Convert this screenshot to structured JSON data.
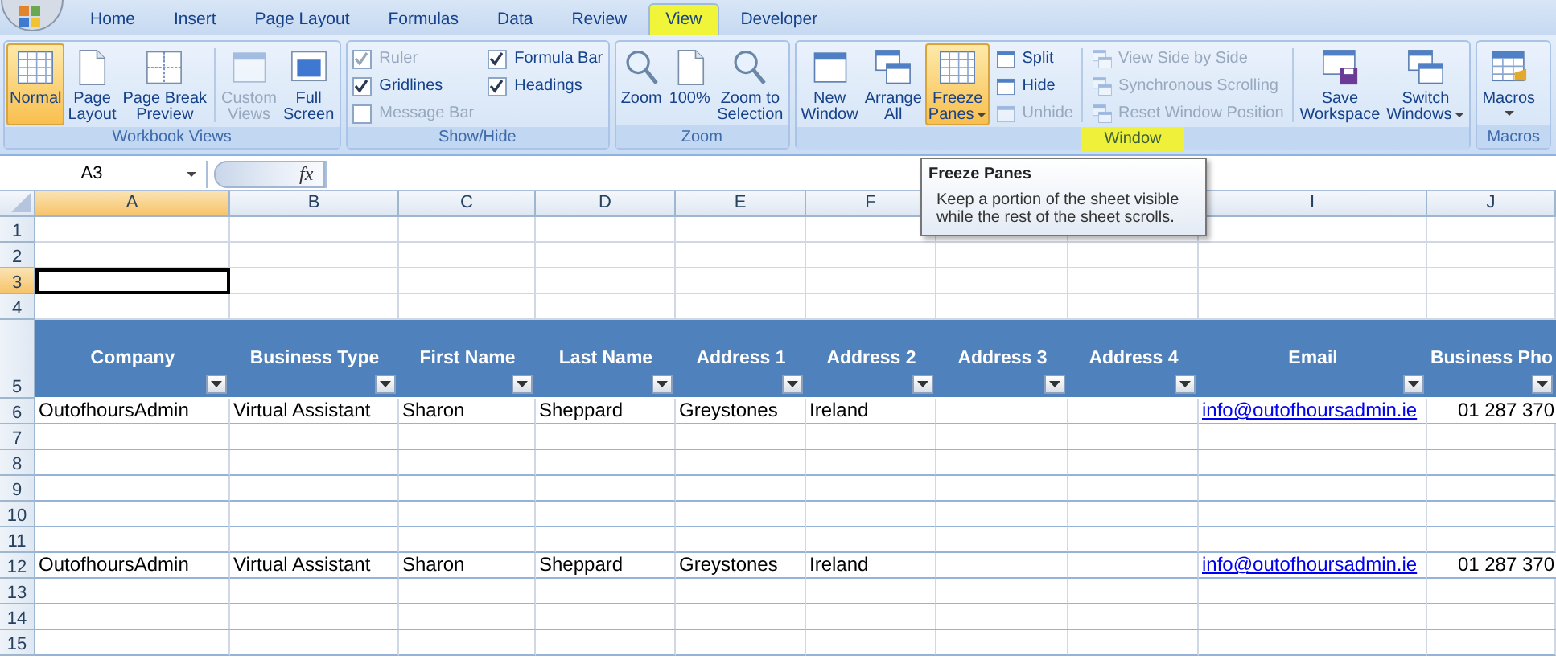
{
  "tabs": [
    {
      "label": "Home",
      "selected": false,
      "highlighted": false
    },
    {
      "label": "Insert",
      "selected": false,
      "highlighted": false
    },
    {
      "label": "Page Layout",
      "selected": false,
      "highlighted": false
    },
    {
      "label": "Formulas",
      "selected": false,
      "highlighted": false
    },
    {
      "label": "Data",
      "selected": false,
      "highlighted": false
    },
    {
      "label": "Review",
      "selected": false,
      "highlighted": false
    },
    {
      "label": "View",
      "selected": true,
      "highlighted": true
    },
    {
      "label": "Developer",
      "selected": false,
      "highlighted": false
    }
  ],
  "ribbon": {
    "groups": [
      {
        "label": "Workbook Views",
        "highlighted": false,
        "items": [
          {
            "kind": "large",
            "label": "Normal",
            "selected": true,
            "disabled": false,
            "dropdown": false
          },
          {
            "kind": "large",
            "label": "Page\nLayout",
            "selected": false,
            "disabled": false,
            "dropdown": false
          },
          {
            "kind": "large",
            "label": "Page Break\nPreview",
            "selected": false,
            "disabled": false,
            "dropdown": false
          },
          {
            "kind": "separator"
          },
          {
            "kind": "large",
            "label": "Custom\nViews",
            "selected": false,
            "disabled": true,
            "dropdown": false
          },
          {
            "kind": "large",
            "label": "Full\nScreen",
            "selected": false,
            "disabled": false,
            "dropdown": false
          }
        ]
      },
      {
        "label": "Show/Hide",
        "highlighted": false,
        "items": [
          {
            "kind": "stack",
            "items": [
              {
                "kind": "check",
                "label": "Ruler",
                "checked": true,
                "disabled": true
              },
              {
                "kind": "check",
                "label": "Gridlines",
                "checked": true,
                "disabled": false
              },
              {
                "kind": "check",
                "label": "Message Bar",
                "checked": false,
                "disabled": true
              }
            ]
          },
          {
            "kind": "stack",
            "items": [
              {
                "kind": "check",
                "label": "Formula Bar",
                "checked": true,
                "disabled": false
              },
              {
                "kind": "check",
                "label": "Headings",
                "checked": true,
                "disabled": false
              }
            ]
          }
        ]
      },
      {
        "label": "Zoom",
        "highlighted": false,
        "items": [
          {
            "kind": "large",
            "label": "Zoom",
            "selected": false,
            "disabled": false,
            "dropdown": false
          },
          {
            "kind": "large",
            "label": "100%",
            "selected": false,
            "disabled": false,
            "dropdown": false
          },
          {
            "kind": "large",
            "label": "Zoom to\nSelection",
            "selected": false,
            "disabled": false,
            "dropdown": false
          }
        ]
      },
      {
        "label": "Window",
        "highlighted": true,
        "items": [
          {
            "kind": "large",
            "label": "New\nWindow",
            "selected": false,
            "disabled": false,
            "dropdown": false
          },
          {
            "kind": "large",
            "label": "Arrange\nAll",
            "selected": false,
            "disabled": false,
            "dropdown": false
          },
          {
            "kind": "large",
            "label": "Freeze\nPanes",
            "selected": true,
            "disabled": false,
            "dropdown": true
          },
          {
            "kind": "stack",
            "items": [
              {
                "kind": "small",
                "label": "Split",
                "disabled": false
              },
              {
                "kind": "small",
                "label": "Hide",
                "disabled": false
              },
              {
                "kind": "small",
                "label": "Unhide",
                "disabled": true
              }
            ]
          },
          {
            "kind": "separator"
          },
          {
            "kind": "stack",
            "items": [
              {
                "kind": "small",
                "label": "View Side by Side",
                "disabled": true
              },
              {
                "kind": "small",
                "label": "Synchronous Scrolling",
                "disabled": true
              },
              {
                "kind": "small",
                "label": "Reset Window Position",
                "disabled": true
              }
            ]
          },
          {
            "kind": "separator"
          },
          {
            "kind": "large",
            "label": "Save\nWorkspace",
            "selected": false,
            "disabled": false,
            "dropdown": false
          },
          {
            "kind": "large",
            "label": "Switch\nWindows",
            "selected": false,
            "disabled": false,
            "dropdown": true
          }
        ]
      },
      {
        "label": "Macros",
        "highlighted": false,
        "items": [
          {
            "kind": "large",
            "label": "Macros",
            "selected": false,
            "disabled": false,
            "dropdown": true
          }
        ]
      }
    ]
  },
  "formula_bar": {
    "name_box": "A3",
    "function_label": "fx"
  },
  "tooltip": {
    "title": "Freeze Panes",
    "text": "Keep a portion of the sheet visible while the rest of the sheet scrolls."
  },
  "sheet": {
    "columns": [
      {
        "kind": "letter",
        "letter": "A",
        "selected": true
      },
      {
        "kind": "letter",
        "letter": "B",
        "selected": false
      },
      {
        "kind": "letter",
        "letter": "C",
        "selected": false
      },
      {
        "kind": "letter",
        "letter": "D",
        "selected": false
      },
      {
        "kind": "letter",
        "letter": "E",
        "selected": false
      },
      {
        "kind": "letter",
        "letter": "F",
        "selected": false
      },
      {
        "kind": "covered"
      },
      {
        "kind": "covered"
      },
      {
        "kind": "letter",
        "letter": "I",
        "selected": false
      },
      {
        "kind": "letter",
        "letter": "J",
        "selected": false
      }
    ],
    "rows": [
      {
        "number": "1",
        "selected": false,
        "kind": "blank"
      },
      {
        "number": "2",
        "selected": false,
        "kind": "blank"
      },
      {
        "number": "3",
        "selected": true,
        "kind": "blank"
      },
      {
        "number": "4",
        "selected": false,
        "kind": "blank"
      },
      {
        "number": "5",
        "selected": false,
        "kind": "header",
        "cells": [
          {
            "text": "Company"
          },
          {
            "text": "Business Type"
          },
          {
            "text": "First Name"
          },
          {
            "text": "Last Name"
          },
          {
            "text": "Address 1"
          },
          {
            "text": "Address 2"
          },
          {
            "text": "Address 3"
          },
          {
            "text": "Address 4"
          },
          {
            "text": "Email"
          },
          {
            "text": "Business Pho"
          }
        ]
      },
      {
        "number": "6",
        "selected": false,
        "kind": "table",
        "cells": [
          {
            "kind": "text",
            "text": "OutofhoursAdmin"
          },
          {
            "kind": "text",
            "text": "Virtual Assistant"
          },
          {
            "kind": "text",
            "text": "Sharon"
          },
          {
            "kind": "text",
            "text": "Sheppard"
          },
          {
            "kind": "text",
            "text": "Greystones"
          },
          {
            "kind": "text",
            "text": "Ireland"
          },
          {
            "kind": "empty"
          },
          {
            "kind": "empty"
          },
          {
            "kind": "link",
            "text": "info@outofhoursadmin.ie"
          },
          {
            "kind": "number",
            "text": "01 287 370"
          }
        ]
      },
      {
        "number": "7",
        "selected": false,
        "kind": "table"
      },
      {
        "number": "8",
        "selected": false,
        "kind": "table"
      },
      {
        "number": "9",
        "selected": false,
        "kind": "table"
      },
      {
        "number": "10",
        "selected": false,
        "kind": "table"
      },
      {
        "number": "11",
        "selected": false,
        "kind": "table"
      },
      {
        "number": "12",
        "selected": false,
        "kind": "table",
        "cells": [
          {
            "kind": "text",
            "text": "OutofhoursAdmin"
          },
          {
            "kind": "text",
            "text": "Virtual Assistant"
          },
          {
            "kind": "text",
            "text": "Sharon"
          },
          {
            "kind": "text",
            "text": "Sheppard"
          },
          {
            "kind": "text",
            "text": "Greystones"
          },
          {
            "kind": "text",
            "text": "Ireland"
          },
          {
            "kind": "empty"
          },
          {
            "kind": "empty"
          },
          {
            "kind": "link",
            "text": "info@outofhoursadmin.ie"
          },
          {
            "kind": "number",
            "text": "01 287 370"
          }
        ]
      },
      {
        "number": "13",
        "selected": false,
        "kind": "table"
      },
      {
        "number": "14",
        "selected": false,
        "kind": "table"
      },
      {
        "number": "15",
        "selected": false,
        "kind": "table"
      }
    ]
  }
}
